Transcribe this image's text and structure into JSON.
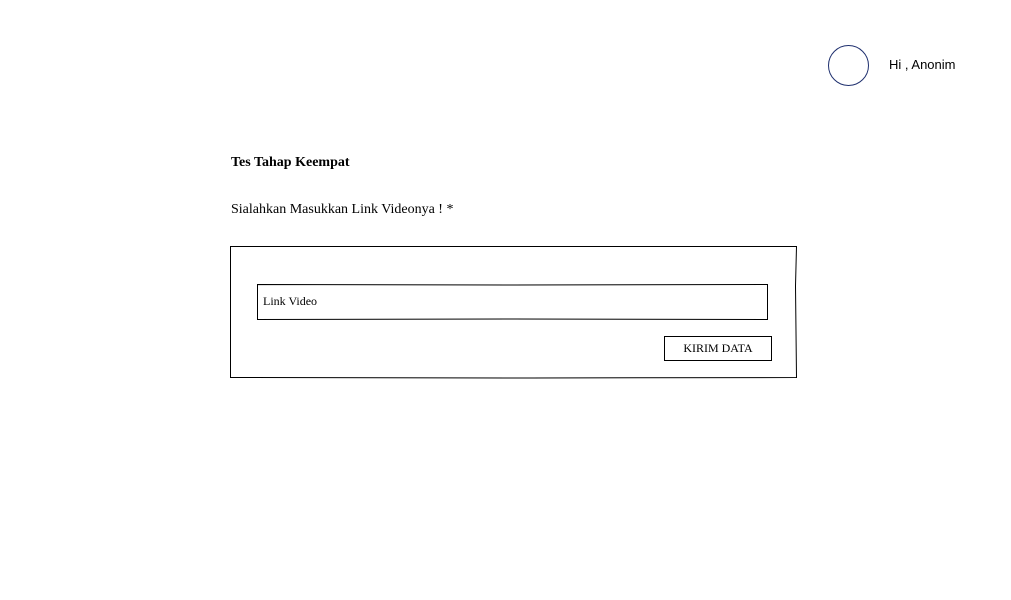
{
  "header": {
    "greeting": "Hi , Anonim"
  },
  "main": {
    "title": "Tes Tahap Keempat",
    "prompt": "Sialahkan Masukkan Link Videonya ! *",
    "link_input": {
      "placeholder": "Link Video",
      "value": ""
    },
    "submit_label": "KIRIM DATA"
  },
  "colors": {
    "avatar_border": "#1e2f6e",
    "text": "#000000",
    "background": "#ffffff"
  }
}
